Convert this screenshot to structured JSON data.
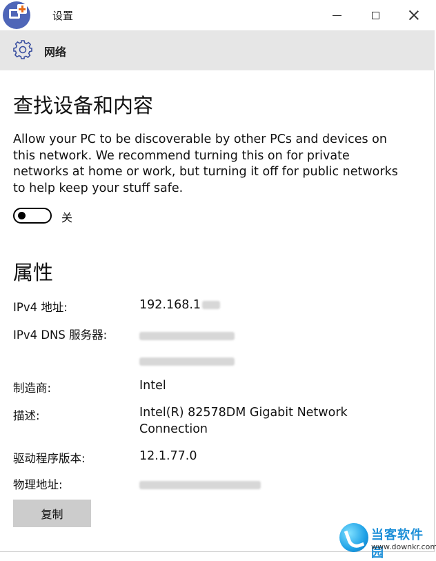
{
  "window": {
    "title": "设置",
    "minimize": "minimize",
    "maximize": "maximize",
    "close": "close"
  },
  "header": {
    "page_name": "网络"
  },
  "discovery": {
    "heading": "查找设备和内容",
    "description": "Allow your PC to be discoverable by other PCs and devices on this network. We recommend turning this on for private networks at home or work, but turning it off for public networks to help keep your stuff safe.",
    "toggle_state": "关"
  },
  "properties": {
    "heading": "属性",
    "ipv4_label": "IPv4 地址:",
    "ipv4_value": "192.168.1",
    "dns_label": "IPv4 DNS 服务器:",
    "manufacturer_label": "制造商:",
    "manufacturer_value": "Intel",
    "description_label": "描述:",
    "description_value": "Intel(R) 82578DM Gigabit Network Connection",
    "driver_label": "驱动程序版本:",
    "driver_value": "12.1.77.0",
    "physical_label": "物理地址:"
  },
  "copy_button": "复制",
  "watermark": {
    "name": "当客软件园",
    "url": "www.downkr.com"
  },
  "colors": {
    "header_band": "#e6e6e6",
    "copy_button": "#cccccc",
    "app_icon": "#4f66b8",
    "app_icon_plus": "#e86a17",
    "watermark": "#1d8fd8"
  }
}
